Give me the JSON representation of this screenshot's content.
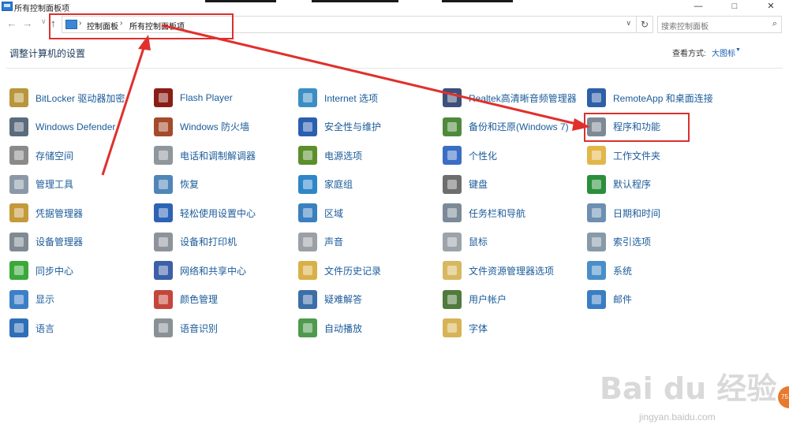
{
  "window": {
    "title": "所有控制面板项",
    "buttons": {
      "minimize": "—",
      "maximize": "□",
      "close": "✕"
    }
  },
  "nav": {
    "back_icon": "←",
    "forward_icon": "→",
    "dropdown_icon": "∨",
    "up_icon": "↑",
    "breadcrumb": [
      "控制面板",
      "所有控制面板项"
    ],
    "separator": "›",
    "refresh_icon": "↻",
    "search_placeholder": "搜索控制面板",
    "search_icon": "⌕"
  },
  "header": {
    "title": "调整计算机的设置",
    "view_label": "查看方式:",
    "view_value": "大图标",
    "view_caret": "▼"
  },
  "items": [
    {
      "label": "BitLocker 驱动器加密",
      "icon": "key-drive-icon",
      "color": "#b9953b"
    },
    {
      "label": "Flash Player",
      "icon": "flash-icon",
      "color": "#8b1d17"
    },
    {
      "label": "Internet 选项",
      "icon": "globe-icon",
      "color": "#3b8ec4"
    },
    {
      "label": "Realtek高清晰音频管理器",
      "icon": "speaker-icon",
      "color": "#3d4f7a"
    },
    {
      "label": "RemoteApp 和桌面连接",
      "icon": "remote-desktop-icon",
      "color": "#2f5fa8"
    },
    {
      "label": "Windows Defender",
      "icon": "castle-wall-icon",
      "color": "#5a6b7c"
    },
    {
      "label": "Windows 防火墙",
      "icon": "firewall-icon",
      "color": "#a54a2a"
    },
    {
      "label": "安全性与维护",
      "icon": "flag-icon",
      "color": "#2b5eb0"
    },
    {
      "label": "备份和还原(Windows 7)",
      "icon": "backup-icon",
      "color": "#4f8a3c"
    },
    {
      "label": "程序和功能",
      "icon": "programs-icon",
      "color": "#7d8a96"
    },
    {
      "label": "存储空间",
      "icon": "storage-icon",
      "color": "#8a8a8a"
    },
    {
      "label": "电话和调制解调器",
      "icon": "phone-modem-icon",
      "color": "#8f969c"
    },
    {
      "label": "电源选项",
      "icon": "power-icon",
      "color": "#5a8f2c"
    },
    {
      "label": "个性化",
      "icon": "personalize-icon",
      "color": "#3a6ec4"
    },
    {
      "label": "工作文件夹",
      "icon": "folder-icon",
      "color": "#e3b64a"
    },
    {
      "label": "管理工具",
      "icon": "admin-tools-icon",
      "color": "#8b99a6"
    },
    {
      "label": "恢复",
      "icon": "recovery-icon",
      "color": "#4f86b8"
    },
    {
      "label": "家庭组",
      "icon": "homegroup-icon",
      "color": "#2e86c8"
    },
    {
      "label": "键盘",
      "icon": "keyboard-icon",
      "color": "#6e6e6e"
    },
    {
      "label": "默认程序",
      "icon": "default-programs-icon",
      "color": "#2a8f3a"
    },
    {
      "label": "凭据管理器",
      "icon": "credential-icon",
      "color": "#c49a3a"
    },
    {
      "label": "轻松使用设置中心",
      "icon": "ease-of-access-icon",
      "color": "#2c63b5"
    },
    {
      "label": "区域",
      "icon": "region-icon",
      "color": "#3a7fc0"
    },
    {
      "label": "任务栏和导航",
      "icon": "taskbar-icon",
      "color": "#7c8a98"
    },
    {
      "label": "日期和时间",
      "icon": "clock-icon",
      "color": "#6d8fb2"
    },
    {
      "label": "设备管理器",
      "icon": "device-manager-icon",
      "color": "#7f8a93"
    },
    {
      "label": "设备和打印机",
      "icon": "printer-icon",
      "color": "#8d939a"
    },
    {
      "label": "声音",
      "icon": "sound-icon",
      "color": "#9aa0a5"
    },
    {
      "label": "鼠标",
      "icon": "mouse-icon",
      "color": "#9ca3a9"
    },
    {
      "label": "索引选项",
      "icon": "indexing-icon",
      "color": "#8899a8"
    },
    {
      "label": "同步中心",
      "icon": "sync-icon",
      "color": "#3aa83a"
    },
    {
      "label": "网络和共享中心",
      "icon": "network-icon",
      "color": "#3d5fa8"
    },
    {
      "label": "文件历史记录",
      "icon": "file-history-icon",
      "color": "#d9b047"
    },
    {
      "label": "文件资源管理器选项",
      "icon": "explorer-options-icon",
      "color": "#d7b861"
    },
    {
      "label": "系统",
      "icon": "system-icon",
      "color": "#4a8ec9"
    },
    {
      "label": "显示",
      "icon": "display-icon",
      "color": "#3b7fc7"
    },
    {
      "label": "颜色管理",
      "icon": "color-management-icon",
      "color": "#c4463a"
    },
    {
      "label": "疑难解答",
      "icon": "troubleshoot-icon",
      "color": "#3c6ea8"
    },
    {
      "label": "用户帐户",
      "icon": "user-accounts-icon",
      "color": "#4f7b3c"
    },
    {
      "label": "邮件",
      "icon": "mail-icon",
      "color": "#3a7dc3"
    },
    {
      "label": "语言",
      "icon": "language-icon",
      "color": "#2f6fb8"
    },
    {
      "label": "语音识别",
      "icon": "microphone-icon",
      "color": "#8a9196"
    },
    {
      "label": "自动播放",
      "icon": "autoplay-icon",
      "color": "#4e9a4e"
    },
    {
      "label": "字体",
      "icon": "font-icon",
      "color": "#d8b356"
    }
  ],
  "watermark": {
    "main": "Bai du 经验",
    "sub": "jingyan.baidu.com",
    "badge": "75"
  },
  "accent": {
    "highlight": "#d9312f",
    "link": "#1b5b99"
  }
}
